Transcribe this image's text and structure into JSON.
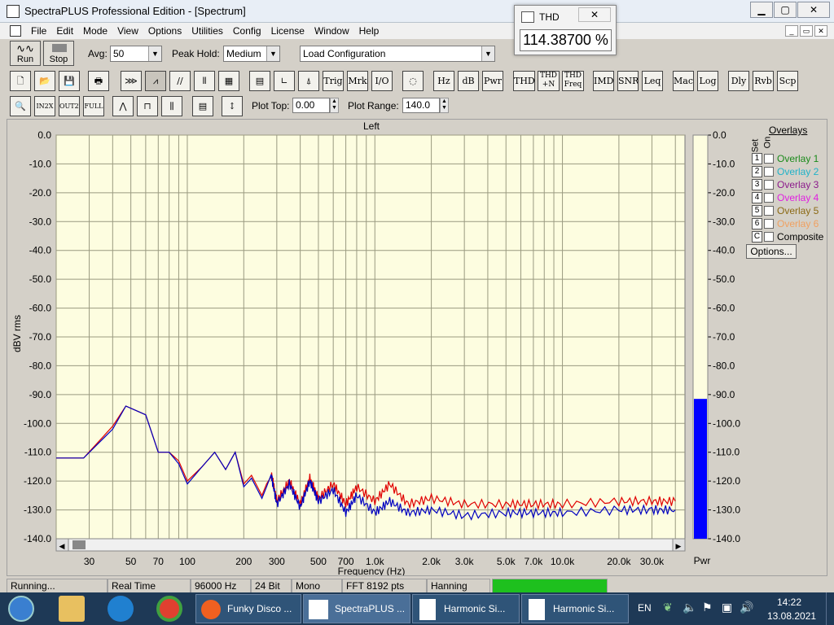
{
  "window": {
    "title": "SpectraPLUS Professional Edition - [Spectrum]"
  },
  "menu": [
    "File",
    "Edit",
    "Mode",
    "View",
    "Options",
    "Utilities",
    "Config",
    "License",
    "Window",
    "Help"
  ],
  "toolbar": {
    "run_label": "Run",
    "stop_label": "Stop",
    "avg_label": "Avg:",
    "avg_value": "50",
    "peak_label": "Peak Hold:",
    "peak_value": "Medium",
    "load_config": "Load Configuration",
    "plot_top_label": "Plot Top:",
    "plot_top_value": "0.00",
    "plot_range_label": "Plot Range:",
    "plot_range_value": "140.0",
    "row2_labels": [
      "Trig",
      "Mrk",
      "I/O",
      "Hz",
      "dB",
      "Pwr",
      "THD",
      "THD\n+N",
      "THD\nFreq",
      "IMD",
      "SNR",
      "Leq",
      "Mac",
      "Log",
      "Dly",
      "Rvb",
      "Scp"
    ]
  },
  "thd_window": {
    "title": "THD",
    "value": "114.38700 %",
    "close": "✕"
  },
  "plot": {
    "channel": "Left",
    "pwr_label": "Pwr"
  },
  "overlays": {
    "title": "Overlays",
    "set_label": "Set",
    "on_label": "On",
    "items": [
      {
        "n": "1",
        "label": "Overlay 1",
        "color": "#1a8a1a"
      },
      {
        "n": "2",
        "label": "Overlay 2",
        "color": "#20b2c8"
      },
      {
        "n": "3",
        "label": "Overlay 3",
        "color": "#8b1a8b"
      },
      {
        "n": "4",
        "label": "Overlay 4",
        "color": "#e020e0"
      },
      {
        "n": "5",
        "label": "Overlay 5",
        "color": "#8b6914"
      },
      {
        "n": "6",
        "label": "Overlay 6",
        "color": "#f0a060"
      },
      {
        "n": "C",
        "label": "Composite",
        "color": "#000000"
      }
    ],
    "options": "Options..."
  },
  "status": [
    "Running...",
    "Real Time",
    "96000 Hz",
    "24 Bit",
    "Mono",
    "FFT 8192 pts",
    "Hanning"
  ],
  "taskbar": {
    "apps": [
      "Funky Disco ...",
      "SpectraPLUS ...",
      "Harmonic Si...",
      "Harmonic Si..."
    ],
    "lang": "EN",
    "time": "14:22",
    "date": "13.08.2021"
  },
  "chart_data": {
    "type": "line",
    "title": "Left",
    "xlabel": "Frequency (Hz)",
    "ylabel": "dBV rms",
    "xscale": "log",
    "xlim": [
      20,
      45000
    ],
    "ylim": [
      -140,
      0
    ],
    "x_ticks": [
      "30",
      "50",
      "70",
      "100",
      "200",
      "300",
      "500",
      "700",
      "1.0k",
      "2.0k",
      "3.0k",
      "5.0k",
      "7.0k",
      "10.0k",
      "20.0k",
      "30.0k"
    ],
    "y_ticks": [
      "0.0",
      "-10.0",
      "-20.0",
      "-30.0",
      "-40.0",
      "-50.0",
      "-60.0",
      "-70.0",
      "-80.0",
      "-90.0",
      "-100.0",
      "-110.0",
      "-120.0",
      "-130.0",
      "-140.0"
    ],
    "colors": {
      "background": "#fdfde0",
      "grid": "#9a9a80"
    },
    "pwr_level_db": -91.5,
    "series": [
      {
        "color": "#e00000",
        "x": [
          20,
          28,
          40,
          47,
          60,
          70,
          80,
          90,
          100,
          120,
          140,
          160,
          180,
          200,
          220,
          250,
          280,
          300,
          350,
          400,
          450,
          500,
          600,
          700,
          800,
          1000,
          1200,
          1500,
          2000,
          3000,
          5000,
          7000,
          10000,
          20000,
          30000,
          40000
        ],
        "y": [
          -112,
          -112,
          -101,
          -94,
          -97,
          -110,
          -110,
          -113,
          -120,
          -115,
          -110,
          -116,
          -110,
          -121,
          -118,
          -125,
          -117,
          -127,
          -120,
          -128,
          -119,
          -126,
          -121,
          -128,
          -122,
          -127,
          -121,
          -128,
          -126,
          -128,
          -128,
          -128,
          -128,
          -127,
          -127,
          -127
        ]
      },
      {
        "color": "#0000c0",
        "x": [
          20,
          28,
          40,
          47,
          60,
          70,
          80,
          90,
          100,
          120,
          140,
          160,
          180,
          200,
          220,
          250,
          280,
          300,
          350,
          400,
          450,
          500,
          600,
          700,
          800,
          1000,
          1200,
          1500,
          2000,
          3000,
          5000,
          7000,
          10000,
          20000,
          30000,
          40000
        ],
        "y": [
          -112,
          -112,
          -102,
          -94,
          -97,
          -110,
          -110,
          -114,
          -121,
          -115,
          -110,
          -116,
          -110,
          -122,
          -119,
          -126,
          -118,
          -128,
          -121,
          -129,
          -120,
          -127,
          -123,
          -131,
          -125,
          -131,
          -127,
          -131,
          -130,
          -132,
          -131,
          -131,
          -131,
          -130,
          -130,
          -130
        ]
      }
    ]
  }
}
